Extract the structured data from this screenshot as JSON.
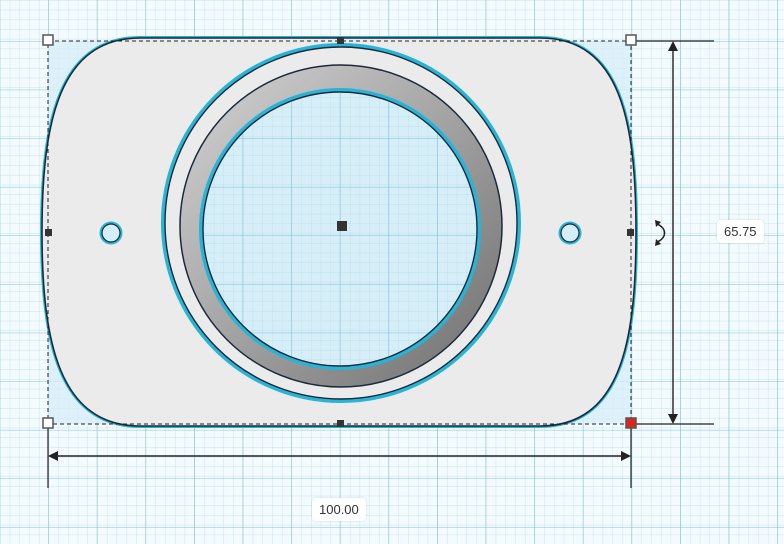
{
  "workplane": {
    "grid_minor_color": "#b8dbe8",
    "grid_major_color": "#7fc1d8",
    "background_color": "#f4fbfe"
  },
  "shape": {
    "fill_color": "#ebebeb",
    "outline_color": "#1a2a3a",
    "highlight_color": "#27b4d6",
    "selection_fill": "#d6eef8"
  },
  "handles": {
    "corner_color": "#ffffff",
    "active_corner_color": "#e0241b",
    "edge_color": "#333333"
  },
  "dimensions": {
    "width_label": "100.00",
    "height_label": "65.75"
  },
  "icons": {
    "rotate": "rotate-arrow-icon"
  }
}
